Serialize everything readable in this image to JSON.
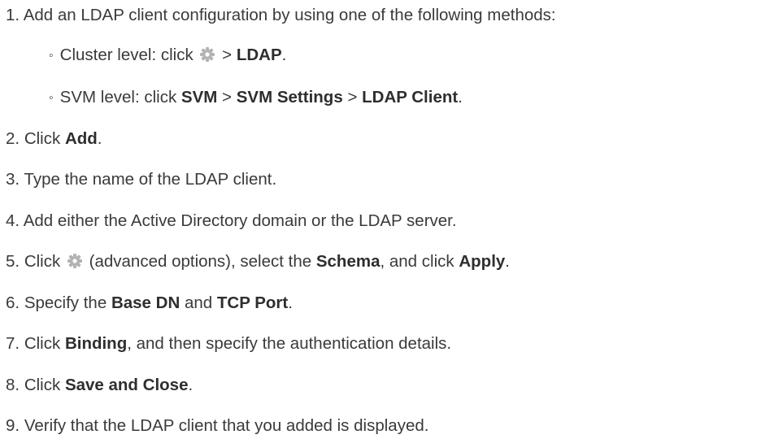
{
  "steps": [
    {
      "number": "1.",
      "text": "Add an LDAP client configuration by using one of the following methods:",
      "substeps": [
        {
          "bullet": "◦",
          "lead": "Cluster level: click",
          "icon": "gear-icon",
          "sep": ">",
          "target": "LDAP",
          "end": "."
        },
        {
          "bullet": "◦",
          "lead": "SVM level: click",
          "t1": "SVM",
          "sep1": ">",
          "t2": "SVM Settings",
          "sep2": ">",
          "t3": "LDAP Client",
          "end": "."
        }
      ]
    },
    {
      "number": "2.",
      "lead": "Click",
      "b1": "Add",
      "end": "."
    },
    {
      "number": "3.",
      "text": "Type the name of the LDAP client."
    },
    {
      "number": "4.",
      "text": "Add either the Active Directory domain or the LDAP server."
    },
    {
      "number": "5.",
      "lead": "Click",
      "icon": "gear-icon",
      "mid1": "(advanced options), select the",
      "b1": "Schema",
      "mid2": ", and click",
      "b2": "Apply",
      "end": "."
    },
    {
      "number": "6.",
      "lead": "Specify the",
      "b1": "Base DN",
      "mid1": "and",
      "b2": "TCP Port",
      "end": "."
    },
    {
      "number": "7.",
      "lead": "Click",
      "b1": "Binding",
      "mid1": ", and then specify the authentication details."
    },
    {
      "number": "8.",
      "lead": "Click",
      "b1": "Save and Close",
      "end": "."
    },
    {
      "number": "9.",
      "text": "Verify that the LDAP client that you added is displayed."
    }
  ],
  "colors": {
    "text": "#3a3a3a",
    "gear": "#b3b3b3"
  }
}
